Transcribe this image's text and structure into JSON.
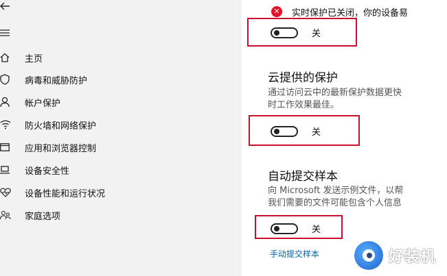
{
  "sidebar": {
    "items": [
      {
        "icon": "home-icon",
        "label": "主页"
      },
      {
        "icon": "shield-icon",
        "label": "病毒和威胁防护"
      },
      {
        "icon": "person-icon",
        "label": "帐户保护"
      },
      {
        "icon": "wifi-icon",
        "label": "防火墙和网络保护"
      },
      {
        "icon": "browser-window-icon",
        "label": "应用和浏览器控制"
      },
      {
        "icon": "laptop-icon",
        "label": "设备安全性"
      },
      {
        "icon": "heart-icon",
        "label": "设备性能和运行状况"
      },
      {
        "icon": "family-icon",
        "label": "家庭选项"
      }
    ]
  },
  "alert": {
    "text": "实时保护已关闭，你的设备易"
  },
  "realtime": {
    "toggle_label": "关"
  },
  "cloud": {
    "title": "云提供的保护",
    "desc_line1": "通过访问云中的最新保护数据更快",
    "desc_line2": "时工作效果最佳。",
    "toggle_label": "关"
  },
  "sample": {
    "title": "自动提交样本",
    "desc_line1": "向 Microsoft 发送示例文件，以帮",
    "desc_line2": "我们需要的文件可能包含个人信息",
    "toggle_label": "关",
    "manual_link": "手动提交样本"
  },
  "watermark": {
    "text": "好装机"
  },
  "colors": {
    "highlight": "#c8102e",
    "alert": "#e81123",
    "link": "#0063b1"
  }
}
